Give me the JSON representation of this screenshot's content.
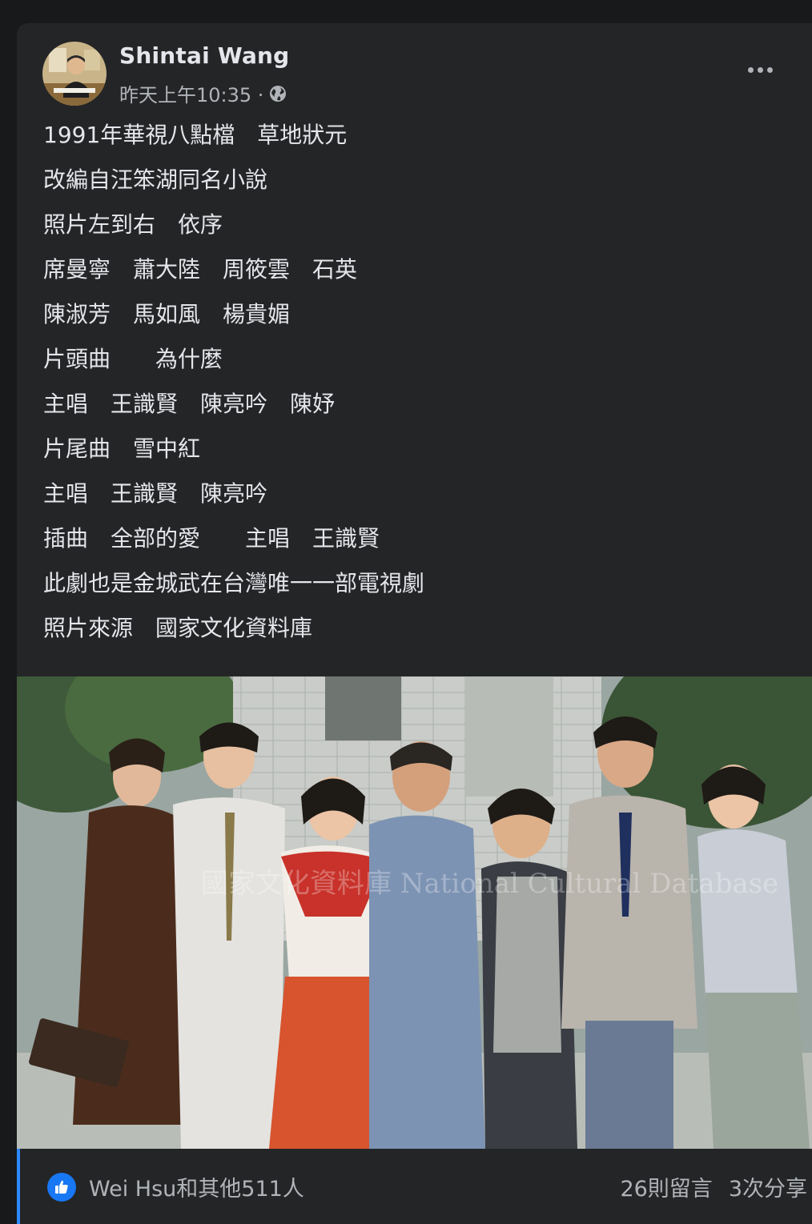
{
  "post": {
    "author": "Shintai Wang",
    "timestamp": "昨天上午10:35 ·",
    "privacy_icon": "globe-icon",
    "more_icon": "more-options-icon",
    "lines": [
      "1991年華視八點檔　草地狀元",
      "改編自汪笨湖同名小說",
      "照片左到右　依序",
      "席曼寧　蕭大陸　周筱雲　石英",
      "陳淑芳　馬如風　楊貴媚",
      "片頭曲　　為什麼",
      "主唱　王識賢　陳亮吟　陳妤",
      "片尾曲　雪中紅",
      "主唱　王識賢　陳亮吟",
      "插曲　全部的愛　　主唱　王識賢",
      "此劇也是金城武在台灣唯一一部電視劇",
      "照片來源　國家文化資料庫"
    ],
    "photo_watermark": "國家文化資料庫 National Cultural Database"
  },
  "footer": {
    "like_icon": "thumbs-up-icon",
    "likes_text": "Wei Hsu和其他511人",
    "comments_text": "26則留言",
    "shares_text": "3次分享"
  },
  "colors": {
    "background": "#18191a",
    "card": "#242526",
    "primary_text": "#e4e6eb",
    "secondary_text": "#b0b3b8",
    "accent": "#1877f2"
  }
}
